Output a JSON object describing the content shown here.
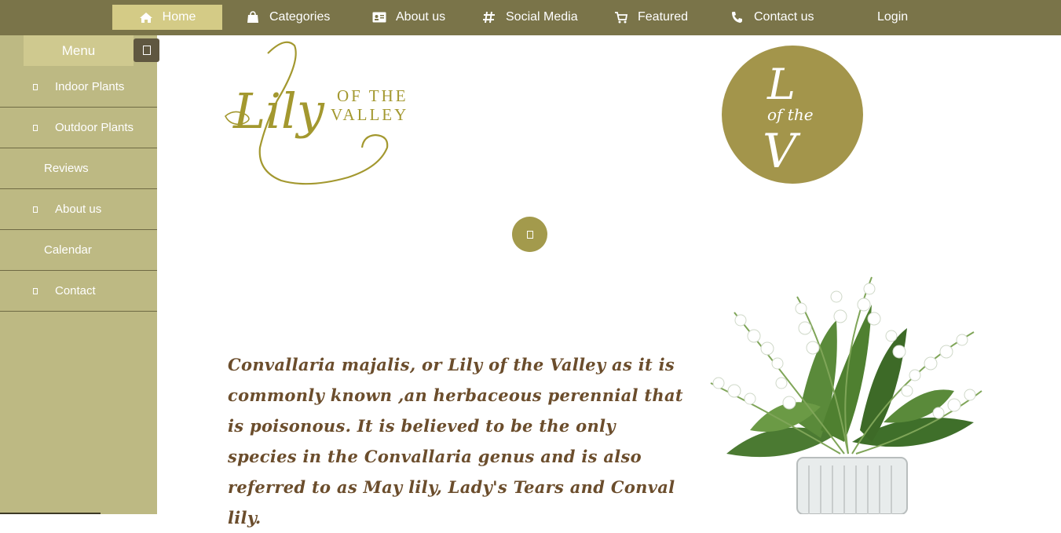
{
  "nav": {
    "home": "Home",
    "categories": "Categories",
    "about": "About us",
    "social": "Social Media",
    "featured": "Featured",
    "contact": "Contact us",
    "login": "Login"
  },
  "sidebar": {
    "title": "Menu",
    "items": [
      {
        "label": "Indoor Plants",
        "has_icon": true
      },
      {
        "label": "Outdoor Plants",
        "has_icon": true
      },
      {
        "label": "Reviews",
        "has_icon": false
      },
      {
        "label": "About us",
        "has_icon": true
      },
      {
        "label": "Calendar",
        "has_icon": false
      },
      {
        "label": "Contact",
        "has_icon": true
      }
    ]
  },
  "logo": {
    "script": "Lily",
    "line1": "OF THE",
    "line2": "VALLEY"
  },
  "circle_logo": {
    "top": "L",
    "middle": "of the",
    "bottom": "V"
  },
  "description": "Convallaria majalis, or Lily of the Valley as it is commonly known ,an herbaceous perennial that is poisonous. It is believed to be the only species in the Convallaria genus and is also referred to as May lily, Lady's Tears and Conval lily.",
  "colors": {
    "nav_bg": "#7a7449",
    "nav_active": "#d4cb86",
    "sidebar_bg": "#bdb983",
    "accent": "#a39a4c",
    "text_brown": "#6b4d2c"
  },
  "icons": {
    "home": "home-icon",
    "categories": "shopping-bag-icon",
    "about": "id-card-icon",
    "social": "hashtag-icon",
    "featured": "cart-icon",
    "contact": "phone-icon"
  }
}
